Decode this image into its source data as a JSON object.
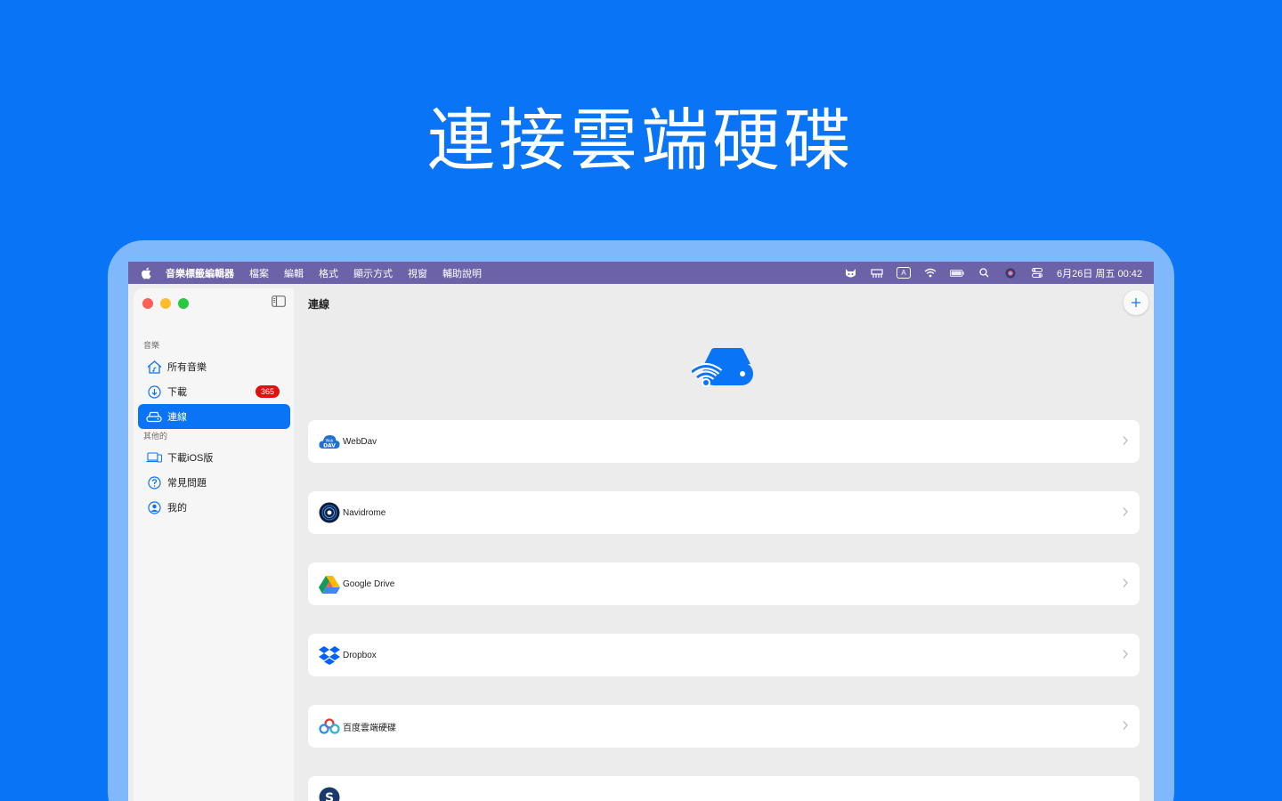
{
  "headline": "連接雲端硬碟",
  "menubar": {
    "app_name": "音樂標籤編輯器",
    "items": [
      "檔案",
      "編輯",
      "格式",
      "顯示方式",
      "視窗",
      "輔助說明"
    ],
    "input_indicator": "A",
    "clock": "6月26日 周五 00:42"
  },
  "sidebar": {
    "section_music": "音樂",
    "section_other": "其他的",
    "items": [
      {
        "label": "所有音樂",
        "icon": "home-music-icon"
      },
      {
        "label": "下載",
        "icon": "download-circle-icon",
        "badge": "365"
      },
      {
        "label": "連線",
        "icon": "drive-icon",
        "active": true
      },
      {
        "label": "下載iOS版",
        "icon": "laptop-phone-icon"
      },
      {
        "label": "常見問題",
        "icon": "question-circle-icon"
      },
      {
        "label": "我的",
        "icon": "person-circle-icon"
      }
    ]
  },
  "content": {
    "title": "連線",
    "services": [
      {
        "label": "WebDav",
        "icon": "webdav-icon"
      },
      {
        "label": "Navidrome",
        "icon": "navidrome-icon"
      },
      {
        "label": "Google Drive",
        "icon": "google-drive-icon"
      },
      {
        "label": "Dropbox",
        "icon": "dropbox-icon"
      },
      {
        "label": "百度雲端硬碟",
        "icon": "baidu-cloud-icon"
      },
      {
        "label": "",
        "icon": "partial-service-icon"
      }
    ]
  },
  "colors": {
    "background": "#0a74f7",
    "device_frame": "#7fb9fb",
    "menubar": "#6b62a8",
    "accent": "#0a74f7",
    "badge": "#e30f0f"
  }
}
